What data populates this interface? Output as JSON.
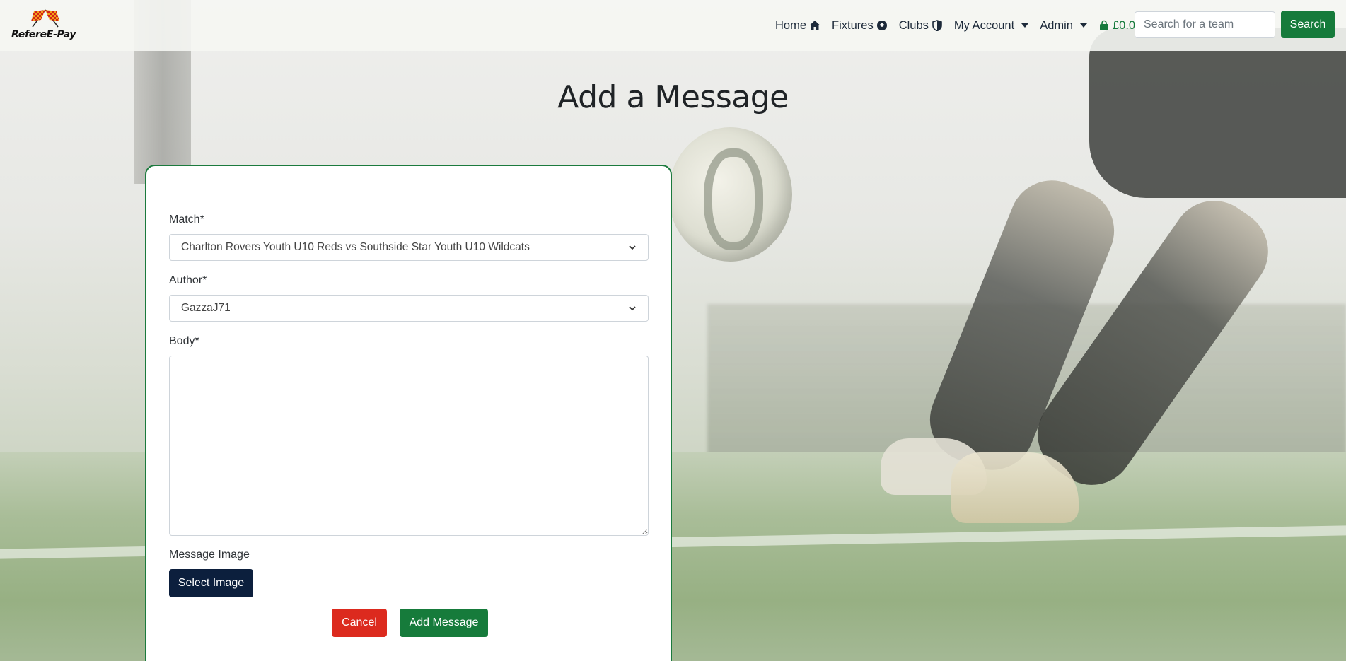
{
  "brand": {
    "name": "RefereE-Pay"
  },
  "nav": {
    "home": "Home",
    "fixtures": "Fixtures",
    "clubs": "Clubs",
    "my_account": "My Account",
    "admin": "Admin",
    "basket": "£0.00"
  },
  "search": {
    "placeholder": "Search for a team",
    "button_label": "Search"
  },
  "page": {
    "title": "Add a Message"
  },
  "form": {
    "match_label": "Match*",
    "match_value": "Charlton Rovers Youth U10 Reds vs Southside Star Youth U10 Wildcats",
    "author_label": "Author*",
    "author_value": "GazzaJ71",
    "body_label": "Body*",
    "body_value": "",
    "image_label": "Message Image",
    "select_image_label": "Select Image",
    "cancel_label": "Cancel",
    "submit_label": "Add Message"
  },
  "colors": {
    "brand_green": "#167b3b",
    "navy": "#0c1f3d",
    "danger": "#dc2a1e",
    "card_border": "#1b7a3d"
  }
}
